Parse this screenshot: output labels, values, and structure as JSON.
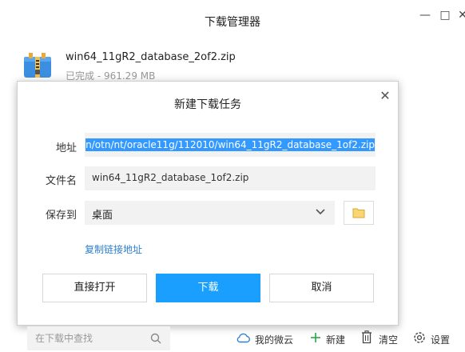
{
  "window": {
    "title": "下载管理器",
    "controls": {
      "minimize": "—",
      "maximize": "□",
      "close": "✕"
    }
  },
  "download_item": {
    "icon": "zip-archive-icon",
    "file_name": "win64_11gR2_database_2of2.zip",
    "status": "已完成 - 961.29 MB"
  },
  "dialog": {
    "title": "新建下载任务",
    "close_glyph": "✕",
    "address_label": "地址",
    "address_value": "n/otn/nt/oracle11g/112010/win64_11gR2_database_1of2.zip",
    "filename_label": "文件名",
    "filename_value": "win64_11gR2_database_1of2.zip",
    "save_to_label": "保存到",
    "save_to_value": "桌面",
    "copy_link_label": "复制链接地址",
    "buttons": {
      "direct_open": "直接打开",
      "download": "下载",
      "cancel": "取消"
    }
  },
  "bottom_bar": {
    "search_placeholder": "在下载中查找",
    "my_cloud": "我的微云",
    "new": "新建",
    "clear": "清空",
    "settings": "设置"
  },
  "colors": {
    "accent": "#1a9fff",
    "link": "#2b7fd0",
    "selection": "#3399ff",
    "new_icon": "#27a845"
  }
}
